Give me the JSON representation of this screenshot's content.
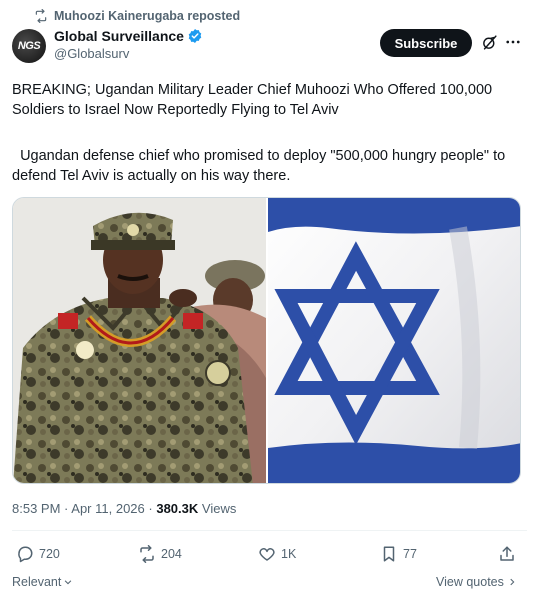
{
  "repost": {
    "text": "Muhoozi Kainerugaba reposted",
    "icon": "repost-icon"
  },
  "author": {
    "avatar_text": "NGS",
    "display_name": "Global Surveillance",
    "handle": "@Globalsurv",
    "verified_color": "#1d9bf0"
  },
  "header": {
    "subscribe_label": "Subscribe",
    "grok_icon": "grok-icon",
    "more_icon": "more-icon"
  },
  "tweet": {
    "paragraph1": "BREAKING; Ugandan Military Leader Chief Muhoozi Who Offered 100,000 Soldiers to Israel Now Reportedly Flying to Tel Aviv",
    "paragraph2": "  Ugandan defense chief who promised to deploy \"500,000 hungry people\" to defend Tel Aviv is actually on his way there."
  },
  "media": {
    "left_image": "military-officer-photo",
    "right_image": "israel-flag-photo",
    "flag_blue": "#2d4fa8"
  },
  "meta": {
    "time": "8:53 PM",
    "date": "Apr 11, 2026",
    "views_count": "380.3K",
    "views_label": "Views"
  },
  "actions": {
    "replies": "720",
    "reposts": "204",
    "likes": "1K",
    "bookmarks": "77"
  },
  "footer": {
    "sort_label": "Relevant",
    "view_quotes_label": "View quotes"
  },
  "colors": {
    "text": "#0f1419",
    "secondary": "#536471",
    "accent": "#1d9bf0",
    "button": "#0f1419"
  }
}
